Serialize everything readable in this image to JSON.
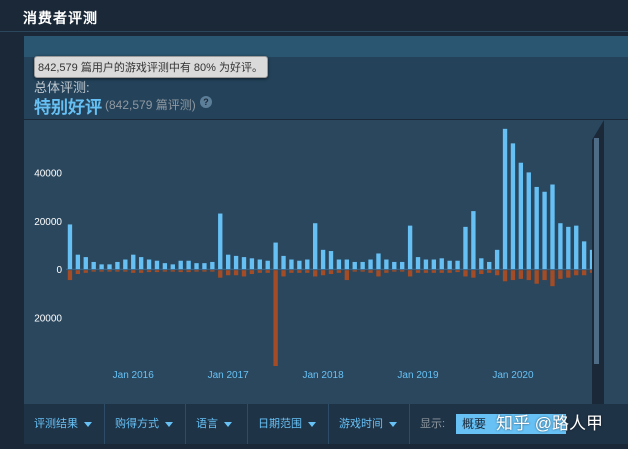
{
  "section": {
    "title": "消费者评测"
  },
  "summary": {
    "label": "总体评测:",
    "rating": "特别好评",
    "count_text": "(842,579 篇评测)",
    "help_icon": "question-icon"
  },
  "tooltip": {
    "text": "842,579 篇用户的游戏评测中有 80% 为好评。"
  },
  "colors": {
    "positive": "#66c0f4",
    "negative": "#a34c25",
    "background": "#2a475e"
  },
  "chart_data": {
    "type": "bar",
    "ylim": [
      -40000,
      60000
    ],
    "yticks": [
      40000,
      20000,
      0,
      -20000
    ],
    "ytick_labels": [
      "40000",
      "20000",
      "0",
      "20000"
    ],
    "xticks": [
      {
        "label": "Jan 2016",
        "index": 8
      },
      {
        "label": "Jan 2017",
        "index": 20
      },
      {
        "label": "Jan 2018",
        "index": 32
      },
      {
        "label": "Jan 2019",
        "index": 44
      },
      {
        "label": "Jan 2020",
        "index": 56
      }
    ],
    "series": [
      {
        "values": [
          18500,
          6000,
          5000,
          3000,
          2000,
          2000,
          3000,
          4000,
          6000,
          5000,
          4000,
          3500,
          2500,
          2000,
          3500,
          3500,
          2500,
          2500,
          3000,
          23000,
          6000,
          5500,
          5000,
          4500,
          4000,
          3500,
          11000,
          5500,
          4000,
          3500,
          4000,
          19000,
          8000,
          7500,
          4000,
          4000,
          3000,
          3000,
          4000,
          6500,
          4000,
          3000,
          3000,
          18000,
          5000,
          4000,
          4000,
          4500,
          3500,
          3500,
          17500,
          24000,
          4500,
          3000,
          8000,
          58000,
          52000,
          44000,
          40000,
          34000,
          32000,
          35000,
          19000,
          17500,
          18000,
          11500,
          8000
        ]
      },
      {
        "values": [
          -4500,
          -2000,
          -1500,
          -1000,
          -1000,
          -1000,
          -1000,
          -1000,
          -1500,
          -1500,
          -1200,
          -1200,
          -1000,
          -1000,
          -1200,
          -1200,
          -1000,
          -1000,
          -1000,
          -3500,
          -2500,
          -2500,
          -3000,
          -2000,
          -1500,
          -1500,
          -40000,
          -3000,
          -1500,
          -1500,
          -1500,
          -3000,
          -2500,
          -2000,
          -1500,
          -4500,
          -1000,
          -1000,
          -1500,
          -3000,
          -1500,
          -1000,
          -1000,
          -3000,
          -1500,
          -1500,
          -1500,
          -1500,
          -1500,
          -1200,
          -3000,
          -3500,
          -2000,
          -1500,
          -2500,
          -5000,
          -4500,
          -4000,
          -4500,
          -6000,
          -4500,
          -7000,
          -4000,
          -3500,
          -2500,
          -2500,
          -1500
        ]
      }
    ]
  },
  "filters": {
    "items": [
      {
        "label": "评测结果"
      },
      {
        "label": "购得方式"
      },
      {
        "label": "语言"
      },
      {
        "label": "日期范围"
      },
      {
        "label": "游戏时间"
      }
    ],
    "display_label": "显示:",
    "display_value": "概要"
  },
  "watermark": {
    "text": "知乎 @路人甲"
  }
}
